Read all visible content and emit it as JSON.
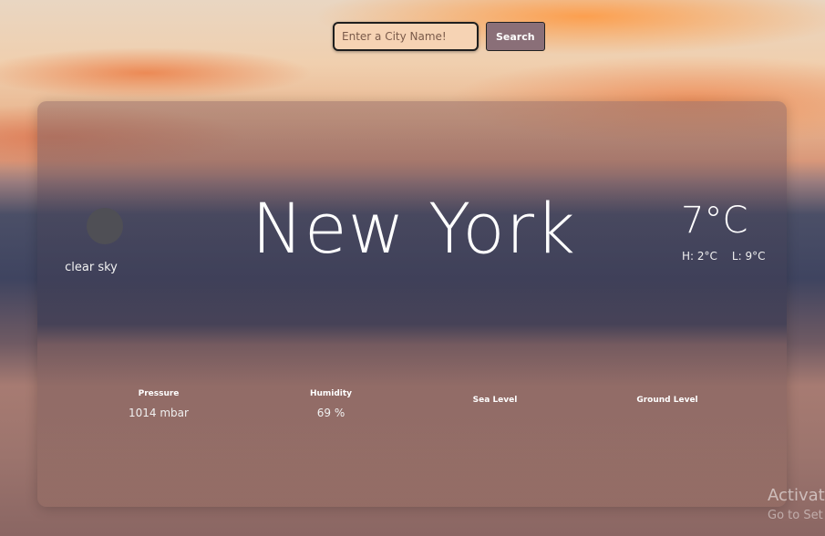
{
  "search": {
    "placeholder": "Enter a City Name!",
    "button_label": "Search"
  },
  "weather": {
    "condition": "clear sky",
    "city": "New York",
    "temperature": "7°C",
    "high": "H: 2°C",
    "low": "L: 9°C"
  },
  "stats": [
    {
      "label": "Pressure",
      "value": "1014 mbar"
    },
    {
      "label": "Humidity",
      "value": "69 %"
    },
    {
      "label": "Sea Level",
      "value": ""
    },
    {
      "label": "Ground Level",
      "value": ""
    }
  ],
  "watermark": {
    "title": "Activat",
    "subtitle": "Go to Set"
  }
}
